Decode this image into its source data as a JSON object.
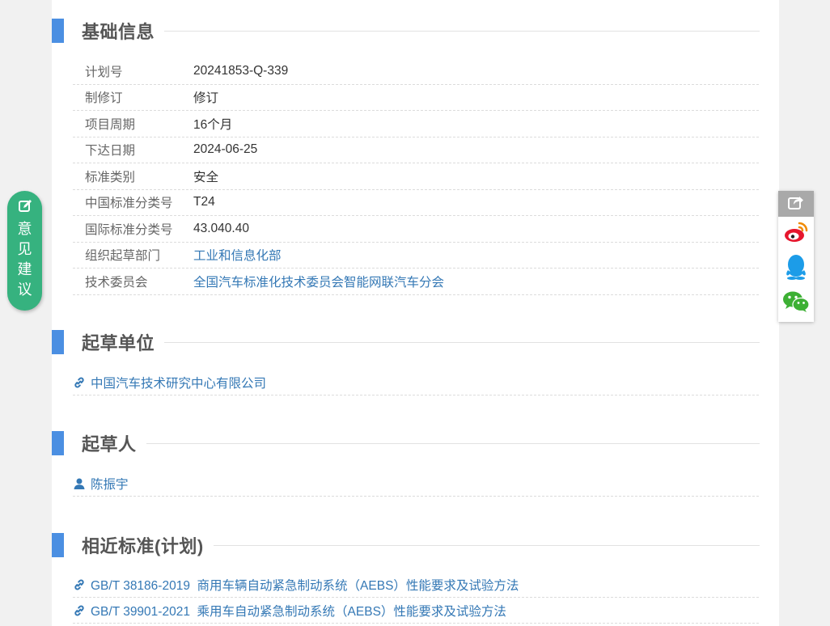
{
  "sections": {
    "basic": "基础信息",
    "drafting_units": "起草单位",
    "drafters": "起草人",
    "related": "相近标准(计划)"
  },
  "info": [
    {
      "key": "计划号",
      "value": "20241853-Q-339",
      "link": false
    },
    {
      "key": "制修订",
      "value": "修订",
      "link": false
    },
    {
      "key": "项目周期",
      "value": "16个月",
      "link": false
    },
    {
      "key": "下达日期",
      "value": "2024-06-25",
      "link": false
    },
    {
      "key": "标准类别",
      "value": "安全",
      "link": false
    },
    {
      "key": "中国标准分类号",
      "value": "T24",
      "link": false
    },
    {
      "key": "国际标准分类号",
      "value": "43.040.40",
      "link": false
    },
    {
      "key": "组织起草部门",
      "value": "工业和信息化部",
      "link": true
    },
    {
      "key": "技术委员会",
      "value": "全国汽车标准化技术委员会智能网联汽车分会",
      "link": true
    }
  ],
  "drafting_units": [
    "中国汽车技术研究中心有限公司"
  ],
  "drafters": [
    "陈振宇"
  ],
  "related_standards": [
    "GB/T 38186-2019  商用车辆自动紧急制动系统（AEBS）性能要求及试验方法",
    "GB/T 39901-2021  乘用车自动紧急制动系统（AEBS）性能要求及试验方法"
  ],
  "feedback": {
    "chars": [
      "意",
      "见",
      "建",
      "议"
    ]
  },
  "share": {
    "icons": [
      "share-icon",
      "weibo-icon",
      "qq-icon",
      "wechat-icon"
    ]
  },
  "colors": {
    "accent": "#4b8fe2",
    "link": "#3478b5",
    "feedback": "#36b27f"
  }
}
